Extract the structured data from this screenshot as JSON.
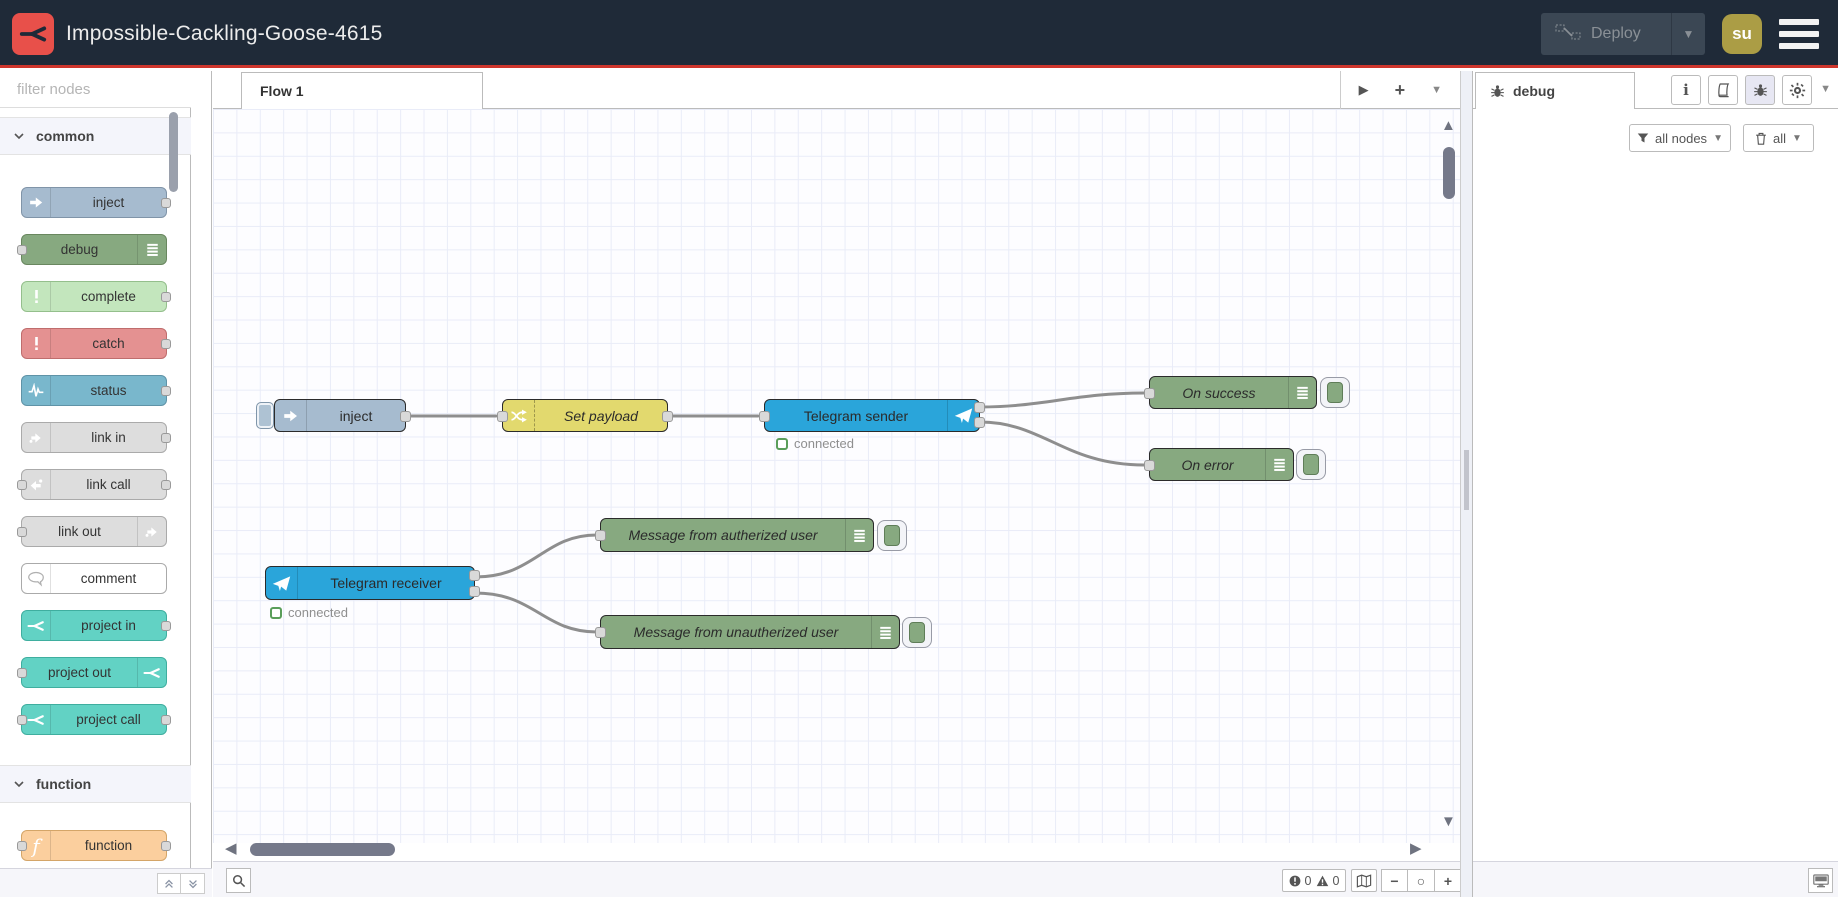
{
  "header": {
    "title": "Impossible-Cackling-Goose-4615",
    "deploy_label": "Deploy",
    "user_initials": "su"
  },
  "palette": {
    "search_placeholder": "filter nodes",
    "categories": [
      {
        "label": "common"
      },
      {
        "label": "function"
      }
    ],
    "nodes": {
      "inject": "inject",
      "debug": "debug",
      "complete": "complete",
      "catch": "catch",
      "status": "status",
      "link_in": "link in",
      "link_call": "link call",
      "link_out": "link out",
      "comment": "comment",
      "project_in": "project in",
      "project_out": "project out",
      "project_call": "project call",
      "function": "function"
    }
  },
  "workspace": {
    "tab_label": "Flow 1",
    "nodes": {
      "inject": {
        "label": "inject"
      },
      "set_payload": {
        "label": "Set payload"
      },
      "telegram_sender": {
        "label": "Telegram sender",
        "status": "connected"
      },
      "on_success": {
        "label": "On success"
      },
      "on_error": {
        "label": "On error"
      },
      "telegram_receiver": {
        "label": "Telegram receiver",
        "status": "connected"
      },
      "msg_authorized": {
        "label": "Message from autherized user"
      },
      "msg_unauthorized": {
        "label": "Message from unautherized user"
      }
    },
    "footer": {
      "error_count": "0",
      "warning_count": "0"
    }
  },
  "sidebar": {
    "tab_label": "debug",
    "filter_button_label": "all nodes",
    "clear_button_label": "all"
  },
  "colors": {
    "header_bg": "#1f2a38",
    "accent_red": "#ce352c",
    "logo_red": "#e8504a",
    "avatar_gold": "#ab9d45",
    "node_inject": "#a6bbcf",
    "node_debug": "#87a980",
    "node_complete": "#c3e6bd",
    "node_catch": "#e49191",
    "node_status": "#79b7cc",
    "node_link": "#dddddd",
    "node_comment": "#ffffff",
    "node_project": "#62d2c4",
    "node_function": "#fbcf9e",
    "node_change": "#e2d96e",
    "node_telegram": "#2aa5da",
    "status_green": "#5a9e5a",
    "wire_gray": "#8e8e8e"
  }
}
